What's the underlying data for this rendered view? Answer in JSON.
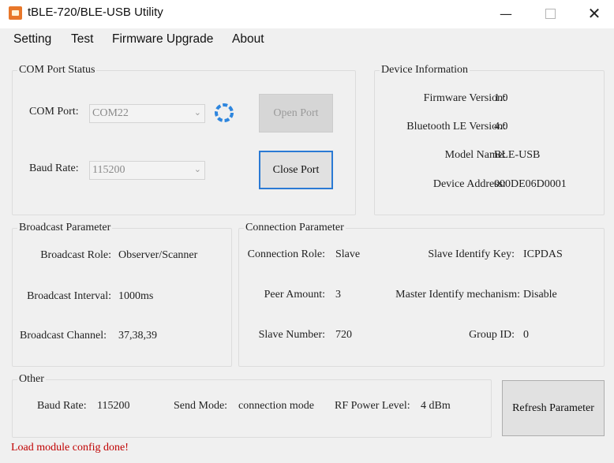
{
  "window": {
    "title": "tBLE-720/BLE-USB Utility"
  },
  "menu": [
    "Setting",
    "Test",
    "Firmware Upgrade",
    "About"
  ],
  "com_port_status": {
    "legend": "COM Port  Status",
    "com_port_label": "COM Port:",
    "com_port_value": "COM22",
    "baud_rate_label": "Baud Rate:",
    "baud_rate_value": "115200",
    "open_port_label": "Open Port",
    "close_port_label": "Close Port"
  },
  "device_info": {
    "legend": "Device Information",
    "firmware_label": "Firmware Version:",
    "firmware_value": "1.0",
    "ble_label": "Bluetooth LE Version:",
    "ble_value": "4.0",
    "model_label": "Model Name:",
    "model_value": "BLE-USB",
    "address_label": "Device Address:",
    "address_value": "000DE06D0001"
  },
  "broadcast": {
    "legend": "Broadcast  Parameter",
    "role_label": "Broadcast Role:",
    "role_value": "Observer/Scanner",
    "interval_label": "Broadcast Interval:",
    "interval_value": "1000ms",
    "channel_label": "Broadcast Channel:",
    "channel_value": "37,38,39"
  },
  "connection": {
    "legend": "Connection  Parameter",
    "role_label": "Connection Role:",
    "role_value": "Slave",
    "peer_label": "Peer Amount:",
    "peer_value": "3",
    "slave_num_label": "Slave Number:",
    "slave_num_value": "720",
    "key_label": "Slave Identify Key:",
    "key_value": "ICPDAS",
    "mechanism_label": "Master Identify mechanism:",
    "mechanism_value": "Disable",
    "group_label": "Group ID:",
    "group_value": "0"
  },
  "other": {
    "legend": "Other",
    "baud_label": "Baud Rate:",
    "baud_value": "115200",
    "send_label": "Send Mode:",
    "send_value": "connection mode",
    "rf_label": "RF Power Level:",
    "rf_value": "4 dBm",
    "refresh_label": "Refresh Parameter"
  },
  "status_text": "Load module config done!",
  "colors": {
    "status_text": "#c00000",
    "focus_border": "#2a7ad4"
  },
  "icons": [
    "app-icon",
    "minimize-icon",
    "maximize-icon",
    "close-icon",
    "refresh-icon",
    "chevron-down-icon"
  ]
}
